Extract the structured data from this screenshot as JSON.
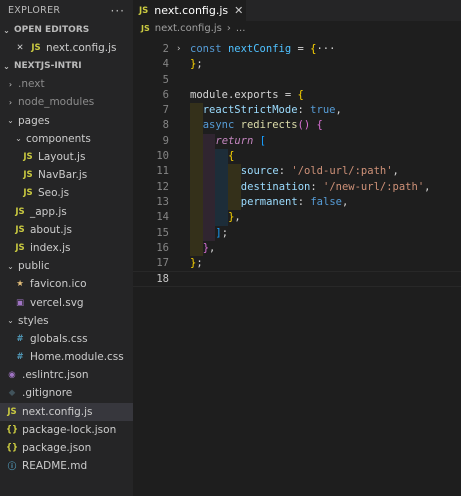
{
  "explorer": {
    "title": "EXPLORER",
    "more": "···",
    "open_editors": {
      "label": "OPEN EDITORS",
      "items": [
        {
          "icon": "JS",
          "name": "next.config.js"
        }
      ]
    },
    "project": {
      "label": "NEXTJS-INTRI",
      "tree": [
        {
          "indent": 1,
          "chevron": "›",
          "icon": "",
          "name": ".next",
          "dim": true
        },
        {
          "indent": 1,
          "chevron": "›",
          "icon": "",
          "name": "node_modules",
          "dim": true
        },
        {
          "indent": 1,
          "chevron": "⌄",
          "icon": "",
          "name": "pages"
        },
        {
          "indent": 2,
          "chevron": "⌄",
          "icon": "",
          "name": "components"
        },
        {
          "indent": 3,
          "chevron": "",
          "icon": "JS",
          "name": "Layout.js"
        },
        {
          "indent": 3,
          "chevron": "",
          "icon": "JS",
          "name": "NavBar.js"
        },
        {
          "indent": 3,
          "chevron": "",
          "icon": "JS",
          "name": "Seo.js"
        },
        {
          "indent": 2,
          "chevron": "",
          "icon": "JS",
          "name": "_app.js"
        },
        {
          "indent": 2,
          "chevron": "",
          "icon": "JS",
          "name": "about.js"
        },
        {
          "indent": 2,
          "chevron": "",
          "icon": "JS",
          "name": "index.js"
        },
        {
          "indent": 1,
          "chevron": "⌄",
          "icon": "",
          "name": "public"
        },
        {
          "indent": 2,
          "chevron": "",
          "icon": "★",
          "name": "favicon.ico"
        },
        {
          "indent": 2,
          "chevron": "",
          "icon": "▣",
          "name": "vercel.svg"
        },
        {
          "indent": 1,
          "chevron": "⌄",
          "icon": "",
          "name": "styles"
        },
        {
          "indent": 2,
          "chevron": "",
          "icon": "#",
          "name": "globals.css"
        },
        {
          "indent": 2,
          "chevron": "",
          "icon": "#",
          "name": "Home.module.css"
        },
        {
          "indent": 1,
          "chevron": "",
          "icon": "◉",
          "name": ".eslintrc.json"
        },
        {
          "indent": 1,
          "chevron": "",
          "icon": "◆",
          "name": ".gitignore"
        },
        {
          "indent": 1,
          "chevron": "",
          "icon": "JS",
          "name": "next.config.js",
          "selected": true
        },
        {
          "indent": 1,
          "chevron": "",
          "icon": "{}",
          "name": "package-lock.json"
        },
        {
          "indent": 1,
          "chevron": "",
          "icon": "{}",
          "name": "package.json"
        },
        {
          "indent": 1,
          "chevron": "",
          "icon": "ⓘ",
          "name": "README.md"
        }
      ]
    }
  },
  "editor": {
    "tab": {
      "icon": "JS",
      "name": "next.config.js",
      "close": "✕"
    },
    "breadcrumb": {
      "icon": "JS",
      "name": "next.config.js",
      "sep": "›",
      "more": "..."
    },
    "lines": [
      {
        "n": "2",
        "fold": "›",
        "indent": 0,
        "tokens": [
          [
            "kw",
            "const "
          ],
          [
            "var",
            "nextConfig"
          ],
          [
            "op",
            " = "
          ],
          [
            "br1",
            "{"
          ],
          [
            "pl",
            "···"
          ]
        ]
      },
      {
        "n": "4",
        "indent": 0,
        "tokens": [
          [
            "br1",
            "}"
          ],
          [
            "pl",
            ";"
          ]
        ]
      },
      {
        "n": "5",
        "indent": 0,
        "tokens": []
      },
      {
        "n": "6",
        "indent": 0,
        "tokens": [
          [
            "pl",
            "module"
          ],
          [
            "pl",
            "."
          ],
          [
            "pl",
            "exports"
          ],
          [
            "op",
            " = "
          ],
          [
            "br1",
            "{"
          ]
        ]
      },
      {
        "n": "7",
        "indent": 1,
        "tokens": [
          [
            "prop",
            "reactStrictMode"
          ],
          [
            "pl",
            ": "
          ],
          [
            "bool",
            "true"
          ],
          [
            "pl",
            ","
          ]
        ]
      },
      {
        "n": "8",
        "indent": 1,
        "tokens": [
          [
            "kw",
            "async "
          ],
          [
            "fn",
            "redirects"
          ],
          [
            "br2",
            "()"
          ],
          [
            "pl",
            " "
          ],
          [
            "br2",
            "{"
          ]
        ]
      },
      {
        "n": "9",
        "indent": 2,
        "tokens": [
          [
            "ctl",
            "return"
          ],
          [
            "pl",
            " "
          ],
          [
            "br3",
            "["
          ]
        ]
      },
      {
        "n": "10",
        "indent": 3,
        "tokens": [
          [
            "br1",
            "{"
          ]
        ]
      },
      {
        "n": "11",
        "indent": 4,
        "tokens": [
          [
            "prop",
            "source"
          ],
          [
            "pl",
            ": "
          ],
          [
            "str",
            "'/old-url/:path'"
          ],
          [
            "pl",
            ","
          ]
        ]
      },
      {
        "n": "12",
        "indent": 4,
        "tokens": [
          [
            "prop",
            "destination"
          ],
          [
            "pl",
            ": "
          ],
          [
            "str",
            "'/new-url/:path'"
          ],
          [
            "pl",
            ","
          ]
        ]
      },
      {
        "n": "13",
        "indent": 4,
        "tokens": [
          [
            "prop",
            "permanent"
          ],
          [
            "pl",
            ": "
          ],
          [
            "bool",
            "false"
          ],
          [
            "pl",
            ","
          ]
        ]
      },
      {
        "n": "14",
        "indent": 3,
        "tokens": [
          [
            "br1",
            "}"
          ],
          [
            "pl",
            ","
          ]
        ]
      },
      {
        "n": "15",
        "indent": 2,
        "tokens": [
          [
            "br3",
            "]"
          ],
          [
            "pl",
            ";"
          ]
        ]
      },
      {
        "n": "16",
        "indent": 1,
        "tokens": [
          [
            "br2",
            "}"
          ],
          [
            "pl",
            ","
          ]
        ]
      },
      {
        "n": "17",
        "indent": 0,
        "tokens": [
          [
            "br1",
            "}"
          ],
          [
            "pl",
            ";"
          ]
        ]
      },
      {
        "n": "18",
        "indent": 0,
        "tokens": [],
        "current": true
      }
    ]
  },
  "colors": {
    "sidebar_bg": "#252526",
    "editor_bg": "#1e1e1e",
    "selection_bg": "#37373d",
    "js_icon": "#cbcb41",
    "css_icon": "#519aba",
    "keyword": "#569cd6",
    "string": "#ce9178",
    "property": "#9cdcfe",
    "function": "#dcdcaa",
    "variable": "#4fc1ff",
    "control": "#c586c0"
  }
}
